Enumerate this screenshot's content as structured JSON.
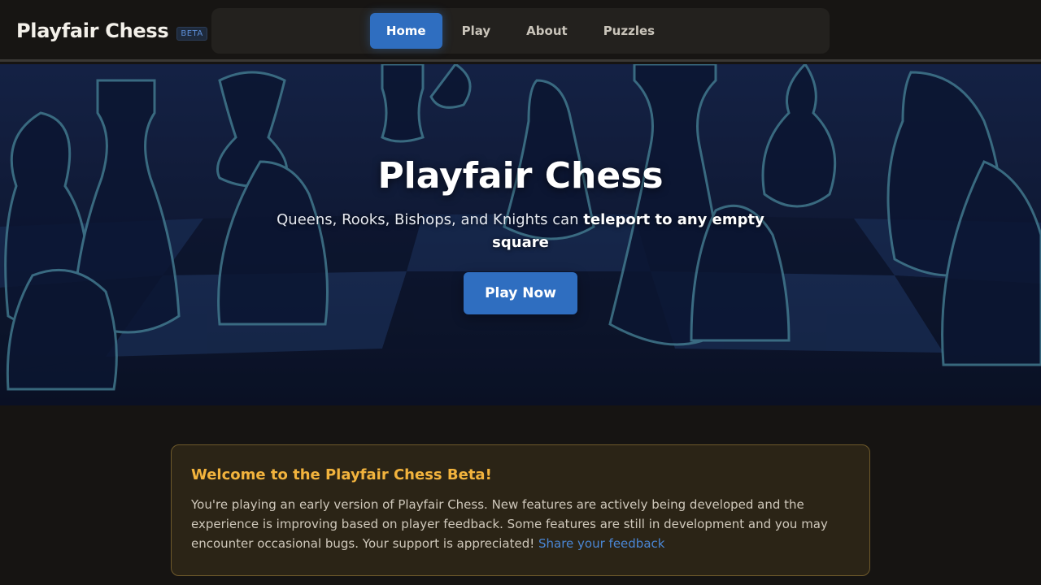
{
  "header": {
    "brand": "Playfair Chess",
    "badge": "BETA",
    "nav": [
      {
        "label": "Home",
        "active": true
      },
      {
        "label": "Play",
        "active": false
      },
      {
        "label": "About",
        "active": false
      },
      {
        "label": "Puzzles",
        "active": false
      }
    ]
  },
  "hero": {
    "title": "Playfair Chess",
    "subtitle_plain": "Queens, Rooks, Bishops, and Knights can ",
    "subtitle_bold": "teleport to any empty square",
    "cta_label": "Play Now"
  },
  "notice": {
    "title": "Welcome to the Playfair Chess Beta!",
    "body": "You're playing an early version of Playfair Chess. New features are actively being developed and the experience is improving based on player feedback. Some features are still in development and you may encounter occasional bugs. Your support is appreciated! ",
    "link_label": "Share your feedback"
  },
  "colors": {
    "accent": "#2f6ec0",
    "notice_title": "#f2b33d",
    "link": "#4a86d4",
    "background": "#161412"
  }
}
